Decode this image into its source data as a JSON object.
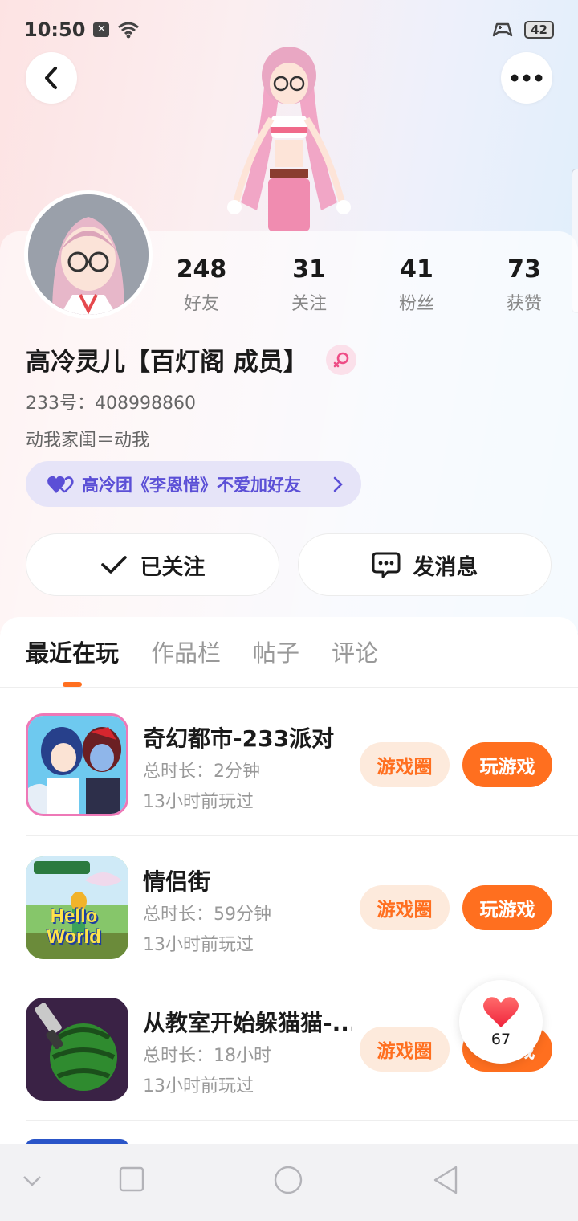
{
  "status_bar": {
    "time": "10:50",
    "battery": "42",
    "icons": [
      "notification-icon",
      "wifi-icon",
      "gamepad-icon",
      "battery-icon"
    ]
  },
  "header": {
    "back_icon": "chevron-left-icon",
    "more_icon": "more-dots-icon"
  },
  "profile": {
    "nickname": "高冷灵儿【百灯阁 成员】",
    "gender_icon": "female-icon",
    "uid": "233号：408998860",
    "bio": "动我家闺＝动我",
    "group_chip": "高冷团《李恩惜》不爱加好友",
    "stats": [
      {
        "value": "248",
        "label": "好友"
      },
      {
        "value": "31",
        "label": "关注"
      },
      {
        "value": "41",
        "label": "粉丝"
      },
      {
        "value": "73",
        "label": "获赞"
      }
    ]
  },
  "actions": {
    "follow_label": "已关注",
    "message_label": "发消息"
  },
  "tabs": [
    "最近在玩",
    "作品栏",
    "帖子",
    "评论"
  ],
  "active_tab": "最近在玩",
  "games": [
    {
      "title": "奇幻都市-233派对",
      "duration": "总时长：2分钟",
      "last_played": "13小时前玩过",
      "circle_label": "游戏圈",
      "play_label": "玩游戏"
    },
    {
      "title": "情侣街",
      "duration": "总时长：59分钟",
      "last_played": "13小时前玩过",
      "circle_label": "游戏圈",
      "play_label": "玩游戏"
    },
    {
      "title": "从教室开始躲猫猫-...",
      "duration": "总时长：18小时",
      "last_played": "13小时前玩过",
      "circle_label": "游戏圈",
      "play_label": "玩游戏"
    }
  ],
  "game2_icon_text": "Hello World",
  "like_float": {
    "count": "67"
  },
  "colors": {
    "accent": "#ff6f1f",
    "accent_light": "#fdeadc",
    "group_purple": "#5b4fd6"
  }
}
